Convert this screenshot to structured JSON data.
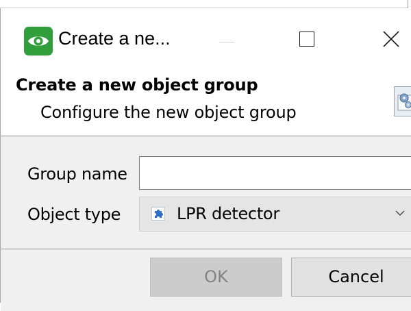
{
  "window": {
    "title": "Create a ne...",
    "app_icon": "eye-icon",
    "accent_color": "#2f9e3b",
    "controls": {
      "minimize": "minimize-icon",
      "maximize": "maximize-icon",
      "close": "close-icon"
    }
  },
  "header": {
    "title": "Create a new object group",
    "subtitle": "Configure the new object group",
    "icon": "wizard-gear-icon"
  },
  "form": {
    "group_name": {
      "label": "Group name",
      "value": ""
    },
    "object_type": {
      "label": "Object type",
      "selected": "LPR detector",
      "option_icon": "puzzle-piece-icon"
    }
  },
  "buttons": {
    "ok": "OK",
    "cancel": "Cancel"
  }
}
